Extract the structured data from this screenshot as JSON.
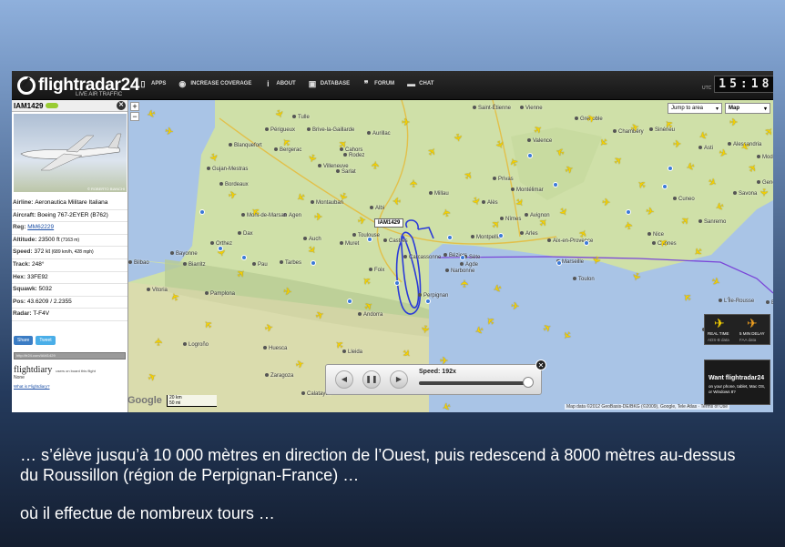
{
  "app": {
    "logo_name": "flightradar24",
    "logo_sub": "LIVE AIR TRAFFIC"
  },
  "nav": [
    {
      "label": "APPS",
      "icon": "phone-icon"
    },
    {
      "label": "INCREASE COVERAGE",
      "icon": "eye-icon"
    },
    {
      "label": "ABOUT",
      "icon": "info-icon"
    },
    {
      "label": "DATABASE",
      "icon": "database-icon"
    },
    {
      "label": "FORUM",
      "icon": "quote-icon"
    },
    {
      "label": "CHAT",
      "icon": "chat-icon"
    }
  ],
  "clock": {
    "utc_label": "UTC",
    "time": "15:18"
  },
  "panel": {
    "flight": "IAM1429",
    "photo_credit": "© ROBERTO BIANCHI",
    "fields": [
      {
        "label": "Airline:",
        "value": "Aeronautica Militare Italiana"
      },
      {
        "label": "Aircraft:",
        "value": "Boeing 767-2EYER (B762)"
      },
      {
        "label": "Reg:",
        "value": "MM62229"
      },
      {
        "label": "Altitude:",
        "value": "23500 ft",
        "extra": "(7163 m)"
      },
      {
        "label": "Speed:",
        "value": "372 kt",
        "extra": "(689 km/h, 428 mph)"
      },
      {
        "label": "Track:",
        "value": "248°"
      },
      {
        "label": "Hex:",
        "value": "33FE92"
      },
      {
        "label": "Squawk:",
        "value": "5032"
      },
      {
        "label": "Pos:",
        "value": "43.6209 / 2.2355"
      },
      {
        "label": "Radar:",
        "value": "T-F4V"
      }
    ],
    "share_fb": "Share",
    "share_tw": "Tweet",
    "url": "http://fr24.com/IAM1429",
    "flightdiary": "flightdiary",
    "flightdiary_tag": "users on board this flight",
    "flightdiary_none": "None",
    "flightdiary_link": "What is Flightdiary?"
  },
  "map": {
    "jump_label": "Jump to area",
    "map_type": "Map",
    "flight_label": "IAM1429",
    "cities": [
      "Saint-Étienne",
      "Vienne",
      "Grenoble",
      "Chambéry",
      "Tulle",
      "Brive-la-Gaillarde",
      "Périgueux",
      "Bergerac",
      "Cahors",
      "Aurillac",
      "Rodez",
      "Valence",
      "Montélimar",
      "Privas",
      "Alès",
      "Nîmes",
      "Avignon",
      "Arles",
      "Aix-en-Provence",
      "Marseille",
      "Toulon",
      "Nice",
      "Cannes",
      "Sanremo",
      "Savona",
      "Genova",
      "Alessandria",
      "Asti",
      "Cuneo",
      "Montauban",
      "Albi",
      "Toulouse",
      "Muret",
      "Auch",
      "Agen",
      "Mont-de-Marsan",
      "Dax",
      "Pau",
      "Tarbes",
      "Bayonne",
      "Biarritz",
      "Béziers",
      "Sète",
      "Agde",
      "Narbonne",
      "Carcassonne",
      "Perpignan",
      "Andorra",
      "Lleida",
      "Huesca",
      "Logroño",
      "Vitoria",
      "Bilbao",
      "Pamplona",
      "Zaragoza",
      "Calatayud",
      "Orthez",
      "Montpellier",
      "Sarlat",
      "Villeneuve",
      "Gujan-Mestras",
      "Blanquefort",
      "Bordeaux",
      "Foix",
      "Castres",
      "Millau",
      "L'Île-Rousse",
      "Chieri",
      "Sinérieu",
      "Bastia",
      "Modena"
    ],
    "google": "Google",
    "scale_km": "20 km",
    "scale_mi": "50 mi",
    "copyright": "Map data ©2012 GeoBasis-DE/BKG (©2009), Google, Tele Atlas · Terms of Use"
  },
  "player": {
    "speed_label": "Speed:",
    "speed_value": "192x"
  },
  "promo": {
    "realtime": "REAL TIME",
    "realtime_sub": "ADS-B data",
    "delay": "5 MIN DELAY",
    "delay_sub": "FAA data",
    "want": "Want flightradar24",
    "on_devices": "on your phone, tablet, Mac OS, or Windows 8?"
  },
  "caption": {
    "line1": "… s’élève jusqu’à 10 000 mètres en direction de l’Ouest, puis redescend à 8000 mètres au-dessus du Roussillon (région de Perpignan-France) …",
    "line2": "où il effectue de nombreux tours …"
  },
  "colors": {
    "plane": "#f7d200",
    "track": "#2a3ad8",
    "route": "#7a46d8",
    "sea": "#a9c4e6"
  }
}
